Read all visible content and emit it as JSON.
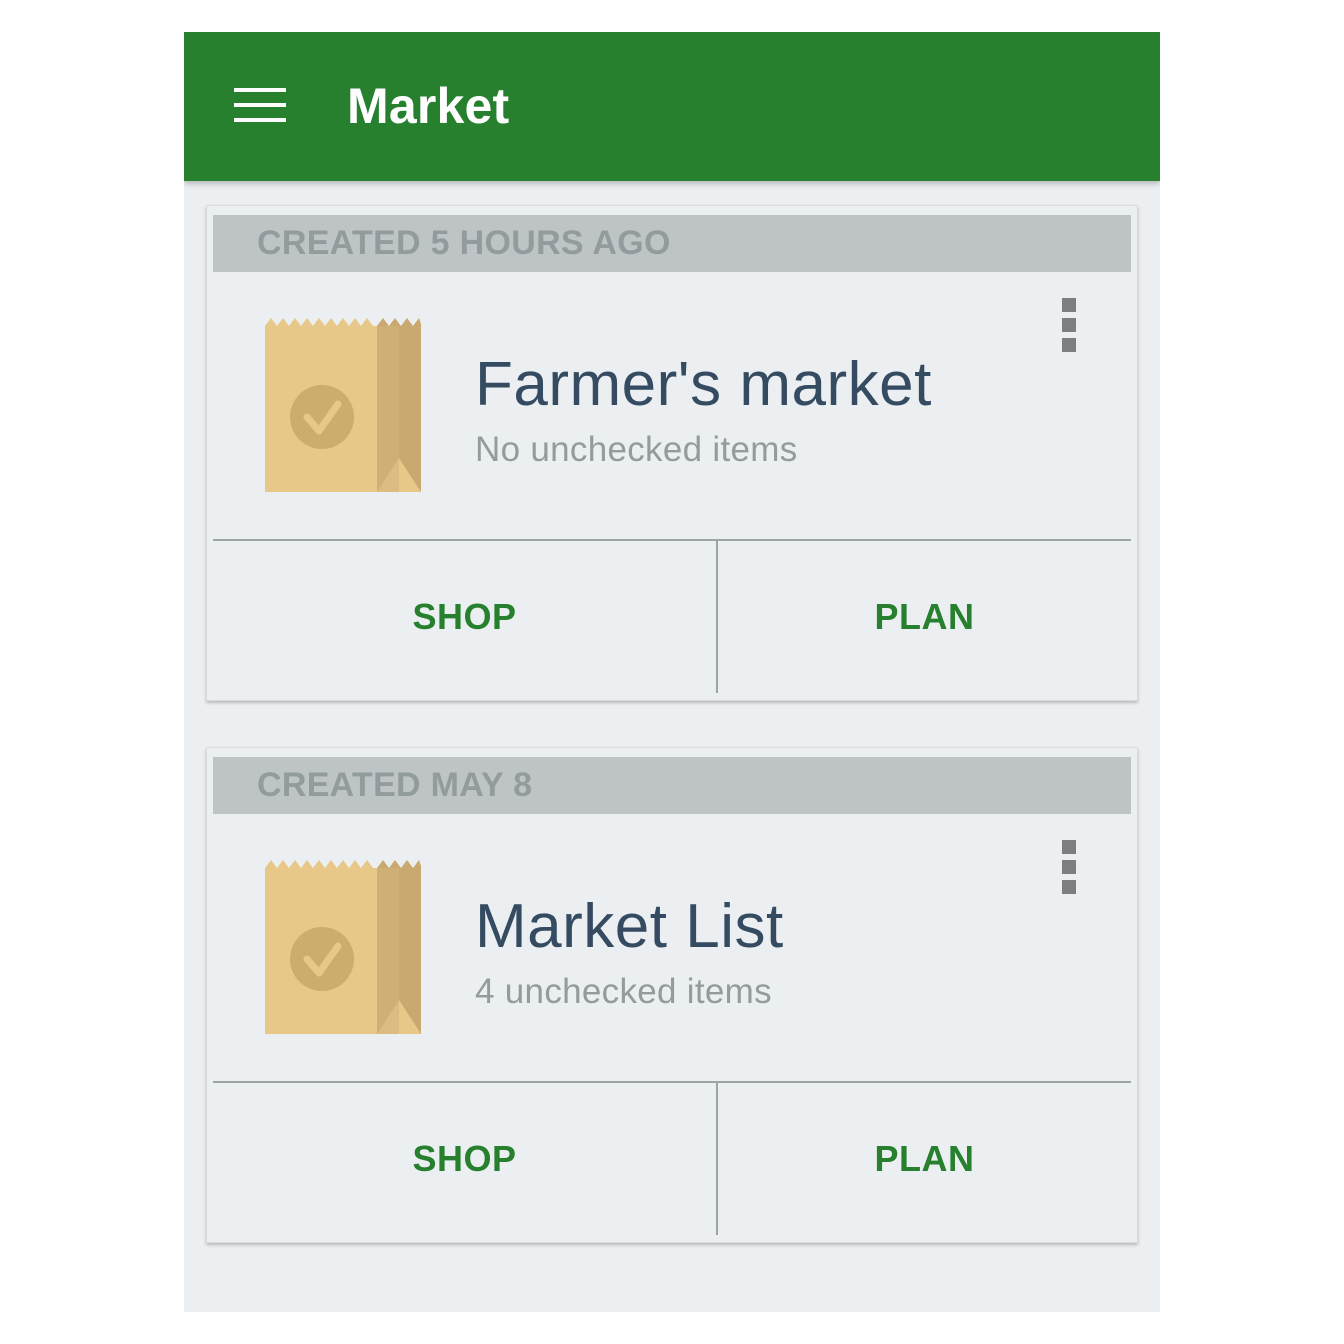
{
  "app": {
    "title": "Market",
    "menu_icon": "hamburger-menu-icon",
    "colors": {
      "app_bar": "#26802e",
      "background": "#eceff1",
      "card_header": "#bec3c6",
      "action_text": "#26802e",
      "title_text": "#354b61",
      "bag": "#e8c888"
    }
  },
  "lists": [
    {
      "created": "CREATED 5 HOURS AGO",
      "name": "Farmer's market",
      "status": "No unchecked items",
      "icon": "shopping-bag-check-icon",
      "shop_label": "SHOP",
      "plan_label": "PLAN"
    },
    {
      "created": "CREATED MAY 8",
      "name": "Market List",
      "status": "4 unchecked items",
      "icon": "shopping-bag-check-icon",
      "shop_label": "SHOP",
      "plan_label": "PLAN"
    }
  ]
}
